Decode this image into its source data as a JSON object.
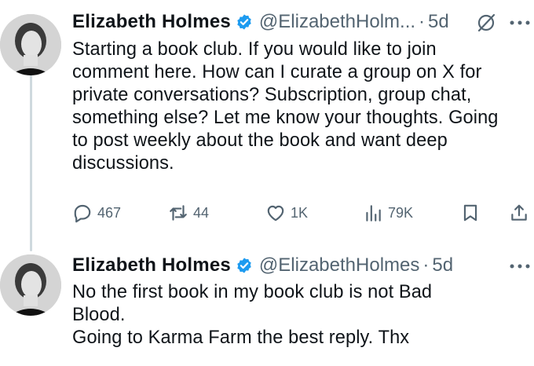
{
  "tweets": [
    {
      "author": "Elizabeth Holmes",
      "handle": "@ElizabethHolm...",
      "separator": "·",
      "time": "5d",
      "text": "Starting a book club. If you would like to join\ncomment here. How can I curate a group on X for\nprivate conversations? Subscription, group chat,\nsomething else? Let me know your thoughts. Going\nto post weekly about the book and want deep\ndiscussions.",
      "stats": {
        "replies": "467",
        "reposts": "44",
        "likes": "1K",
        "views": "79K"
      }
    },
    {
      "author": "Elizabeth Holmes",
      "handle": "@ElizabethHolmes",
      "separator": "·",
      "time": "5d",
      "text": "No the first  book in my book club is not Bad\nBlood.\n Going to Karma Farm the best reply. Thx"
    }
  ],
  "colors": {
    "verified": "#1d9bf0",
    "muted": "#536471",
    "thread_line": "#cfd9de"
  },
  "icons": [
    "verified-badge-icon",
    "grok-icon",
    "more-icon",
    "reply-icon",
    "repost-icon",
    "like-icon",
    "views-icon",
    "bookmark-icon",
    "share-icon"
  ]
}
